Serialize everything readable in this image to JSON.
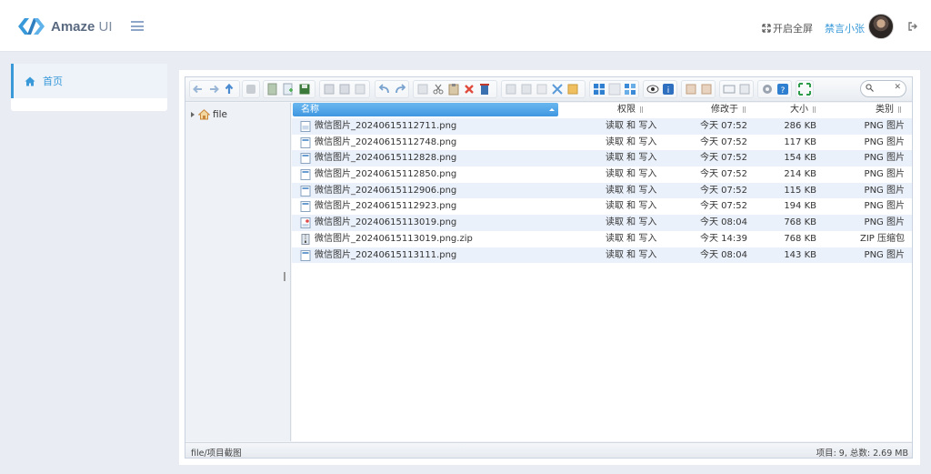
{
  "header": {
    "brand": "Amaze",
    "brand_suffix": " UI",
    "fullscreen_label": "开启全屏",
    "username": "禁言小张"
  },
  "sidebar": {
    "items": [
      {
        "label": "首页",
        "icon": "home-icon"
      }
    ]
  },
  "colors": {
    "accent": "#3a9ad9",
    "header_bg": "#ffffff",
    "page_bg": "#e9ecf3",
    "selected_column": "#4fa6e8",
    "row_alt": "#eaf1fb"
  },
  "file_manager": {
    "tree": {
      "root_label": "file"
    },
    "columns": {
      "name": "名称",
      "perm": "权限",
      "modified": "修改于",
      "size": "大小",
      "kind": "类别"
    },
    "files": [
      {
        "name": "微信图片_20240615112711.png",
        "perm": "读取 和 写入",
        "modified": "今天 07:52",
        "size": "286 KB",
        "kind": "PNG 图片",
        "icon": "image-file-icon"
      },
      {
        "name": "微信图片_20240615112748.png",
        "perm": "读取 和 写入",
        "modified": "今天 07:52",
        "size": "117 KB",
        "kind": "PNG 图片",
        "icon": "image-file-icon"
      },
      {
        "name": "微信图片_20240615112828.png",
        "perm": "读取 和 写入",
        "modified": "今天 07:52",
        "size": "154 KB",
        "kind": "PNG 图片",
        "icon": "image-file-icon"
      },
      {
        "name": "微信图片_20240615112850.png",
        "perm": "读取 和 写入",
        "modified": "今天 07:52",
        "size": "214 KB",
        "kind": "PNG 图片",
        "icon": "image-file-icon"
      },
      {
        "name": "微信图片_20240615112906.png",
        "perm": "读取 和 写入",
        "modified": "今天 07:52",
        "size": "115 KB",
        "kind": "PNG 图片",
        "icon": "image-file-icon"
      },
      {
        "name": "微信图片_20240615112923.png",
        "perm": "读取 和 写入",
        "modified": "今天 07:52",
        "size": "194 KB",
        "kind": "PNG 图片",
        "icon": "image-file-icon"
      },
      {
        "name": "微信图片_20240615113019.png",
        "perm": "读取 和 写入",
        "modified": "今天 08:04",
        "size": "768 KB",
        "kind": "PNG 图片",
        "icon": "image-file-icon"
      },
      {
        "name": "微信图片_20240615113019.png.zip",
        "perm": "读取 和 写入",
        "modified": "今天 14:39",
        "size": "768 KB",
        "kind": "ZIP 压缩包",
        "icon": "zip-file-icon"
      },
      {
        "name": "微信图片_20240615113111.png",
        "perm": "读取 和 写入",
        "modified": "今天 08:04",
        "size": "143 KB",
        "kind": "PNG 图片",
        "icon": "image-file-icon"
      }
    ],
    "status_path": "file/项目截图",
    "status_stats": "项目: 9, 总数: 2.69 MB"
  }
}
